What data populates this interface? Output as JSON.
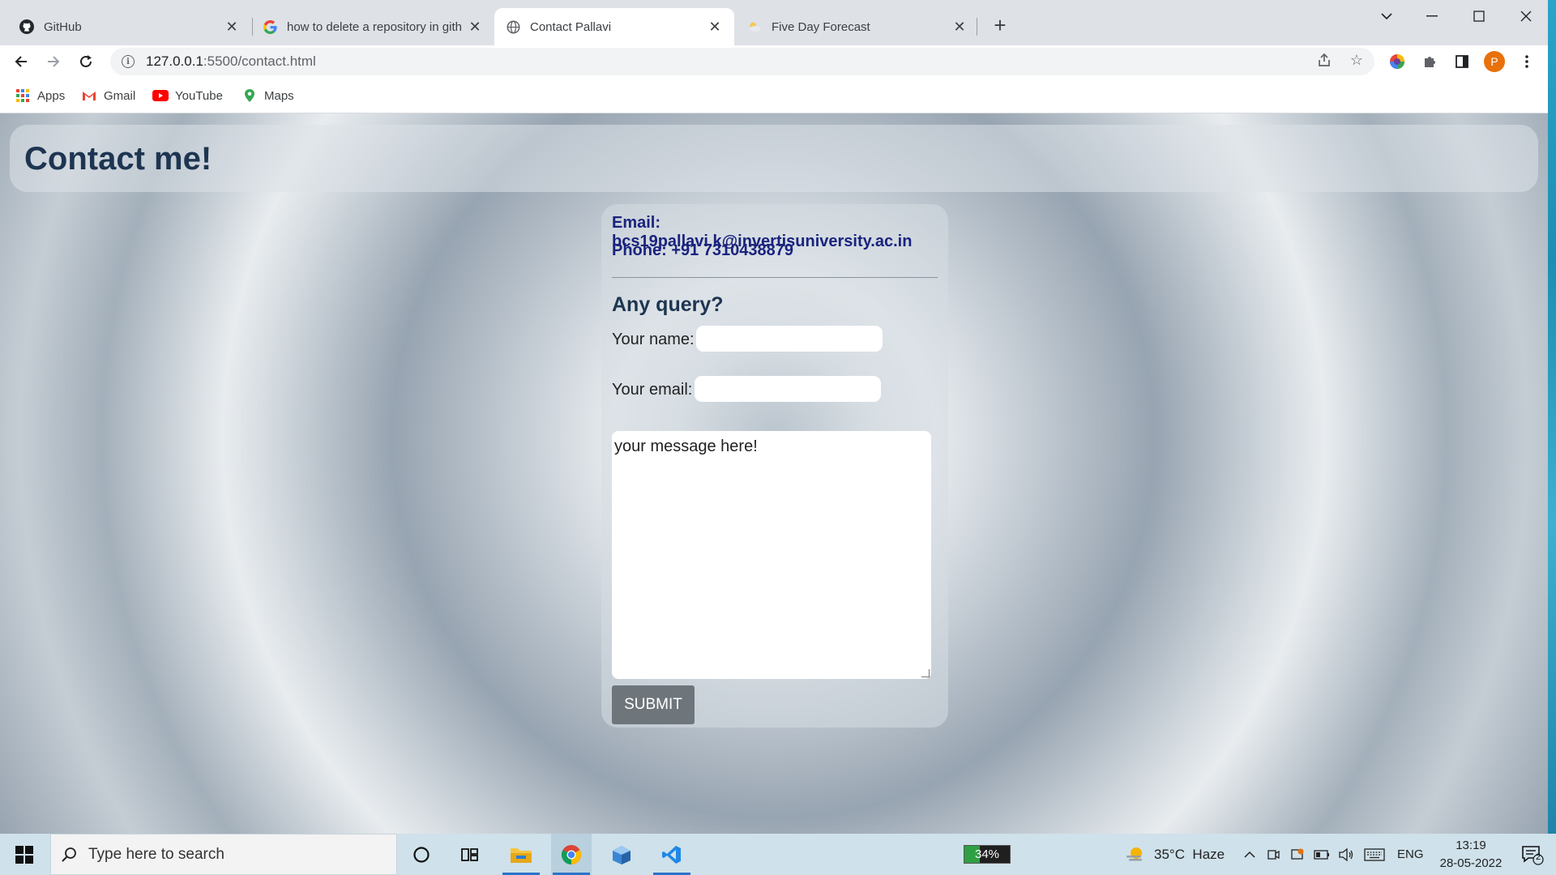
{
  "browser": {
    "tabs": [
      {
        "title": "GitHub",
        "icon": "github-icon"
      },
      {
        "title": "how to delete a repository in gith",
        "icon": "google-icon"
      },
      {
        "title": "Contact Pallavi",
        "icon": "globe-icon"
      },
      {
        "title": "Five Day Forecast",
        "icon": "weather-cloud-icon"
      }
    ],
    "url_host": "127.0.0.1",
    "url_path": ":5500/contact.html",
    "profile_initial": "P",
    "bookmarks": [
      "Apps",
      "Gmail",
      "YouTube",
      "Maps"
    ]
  },
  "page": {
    "heading": "Contact me!",
    "email_line": "Email: bcs19pallavi.k@invertisuniversity.ac.in",
    "phone_line": "Phone: +91 7310438879",
    "query_heading": "Any query?",
    "name_label": "Your name:",
    "name_value": "",
    "email_label": "Your email:",
    "email_value": "",
    "message_text": "your message here!",
    "submit_label": "SUBMIT"
  },
  "taskbar": {
    "search_placeholder": "Type here to search",
    "battery": "34%",
    "battery_level": 0.34,
    "weather": "35°C  Haze",
    "language": "ENG",
    "time": "13:19",
    "date": "28-05-2022",
    "notifications": "2"
  },
  "colors": {
    "heading": "#1d3551",
    "contact_text": "#1a237e",
    "submit_bg": "#6e767c",
    "taskbar_bg": "#cfe1ea"
  }
}
